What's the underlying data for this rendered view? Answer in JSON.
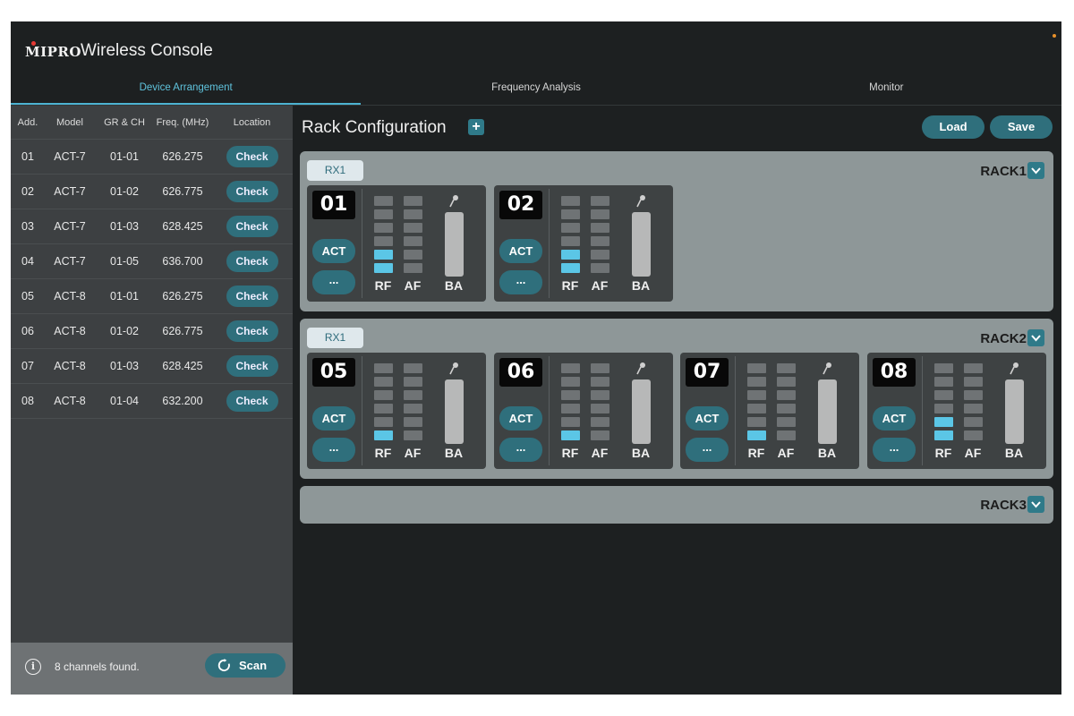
{
  "app": {
    "logo": "MIPRO",
    "title": "Wireless Console"
  },
  "tabs": [
    {
      "label": "Device Arrangement",
      "active": true
    },
    {
      "label": "Frequency Analysis",
      "active": false
    },
    {
      "label": "Monitor",
      "active": false
    }
  ],
  "table": {
    "headers": [
      "Add.",
      "Model",
      "GR & CH",
      "Freq. (MHz)",
      "Location"
    ],
    "rows": [
      {
        "add": "01",
        "model": "ACT-7",
        "grch": "01-01",
        "freq": "626.275",
        "location": "Check"
      },
      {
        "add": "02",
        "model": "ACT-7",
        "grch": "01-02",
        "freq": "626.775",
        "location": "Check"
      },
      {
        "add": "03",
        "model": "ACT-7",
        "grch": "01-03",
        "freq": "628.425",
        "location": "Check"
      },
      {
        "add": "04",
        "model": "ACT-7",
        "grch": "01-05",
        "freq": "636.700",
        "location": "Check"
      },
      {
        "add": "05",
        "model": "ACT-8",
        "grch": "01-01",
        "freq": "626.275",
        "location": "Check"
      },
      {
        "add": "06",
        "model": "ACT-8",
        "grch": "01-02",
        "freq": "626.775",
        "location": "Check"
      },
      {
        "add": "07",
        "model": "ACT-8",
        "grch": "01-03",
        "freq": "628.425",
        "location": "Check"
      },
      {
        "add": "08",
        "model": "ACT-8",
        "grch": "01-04",
        "freq": "632.200",
        "location": "Check"
      }
    ]
  },
  "footer": {
    "status": "8 channels found.",
    "scan_label": "Scan"
  },
  "rack_config": {
    "title": "Rack Configuration",
    "load_label": "Load",
    "save_label": "Save"
  },
  "racks": [
    {
      "label": "RACK1",
      "rx": "RX1",
      "channels": [
        {
          "num": "01",
          "act": "ACT",
          "more": "...",
          "rf_level": 2,
          "af_level": 0
        },
        {
          "num": "02",
          "act": "ACT",
          "more": "...",
          "rf_level": 2,
          "af_level": 0
        }
      ]
    },
    {
      "label": "RACK2",
      "rx": "RX1",
      "channels": [
        {
          "num": "05",
          "act": "ACT",
          "more": "...",
          "rf_level": 1,
          "af_level": 0
        },
        {
          "num": "06",
          "act": "ACT",
          "more": "...",
          "rf_level": 1,
          "af_level": 0
        },
        {
          "num": "07",
          "act": "ACT",
          "more": "...",
          "rf_level": 1,
          "af_level": 0
        },
        {
          "num": "08",
          "act": "ACT",
          "more": "...",
          "rf_level": 2,
          "af_level": 0
        }
      ]
    },
    {
      "label": "RACK3"
    }
  ],
  "meter_labels": {
    "rf": "RF",
    "af": "AF",
    "ba": "BA"
  },
  "colors": {
    "accent": "#2f6f7c",
    "meter_on": "#5bc6e6",
    "rack_bg": "#8e9798"
  },
  "icons": {
    "info": "info-icon",
    "scan": "refresh-icon",
    "add": "plus-icon",
    "toggle": "chevron-down-icon",
    "mic": "microphone-icon"
  }
}
